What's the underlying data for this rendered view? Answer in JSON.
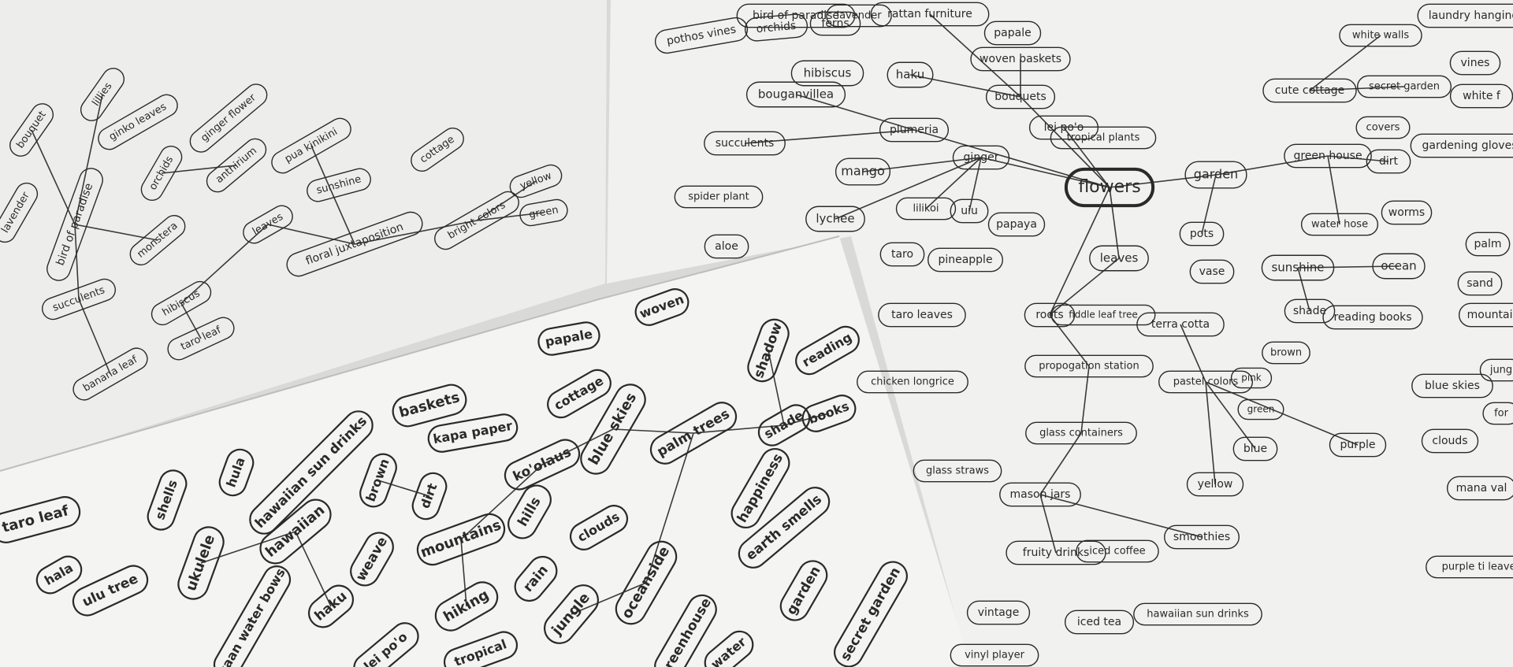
{
  "center_label": "flowers",
  "sheet_right": {
    "words": [
      "pothos vines",
      "orchids",
      "ferns",
      "bird of paradise",
      "lavender",
      "rattan furniture",
      "papale",
      "haku",
      "woven baskets",
      "bouquets",
      "bouganvillea",
      "hibiscus",
      "plumeria",
      "lei po'o",
      "tropical plants",
      "succulents",
      "ginger",
      "mango",
      "spider plant",
      "lychee",
      "lilikoi",
      "uiu",
      "papaya",
      "aloe",
      "taro",
      "pineapple",
      "taro leaves",
      "leaves",
      "roots",
      "fiddle leaf tree",
      "terra cotta",
      "pots",
      "vase",
      "garden",
      "dirt",
      "gardening gloves",
      "green house",
      "water hose",
      "worms",
      "cute cottage",
      "white walls",
      "secret garden",
      "vines",
      "white f",
      "covers",
      "laundry hanging",
      "sunshine",
      "shade",
      "reading books",
      "ocean",
      "palm",
      "sand",
      "mountain",
      "blue skies",
      "clouds",
      "jung",
      "for",
      "mana val",
      "purple ti leaves",
      "propogation station",
      "glass containers",
      "glass straws",
      "mason jars",
      "fruity drinks",
      "iced coffee",
      "smoothies",
      "pastel colors",
      "brown",
      "pink",
      "green",
      "blue",
      "purple",
      "yellow",
      "iced tea",
      "hawaiian sun drinks",
      "vintage",
      "vinyl player",
      "chicken longrice"
    ]
  },
  "sheet_left": {
    "words": [
      "bouquet",
      "lillies",
      "ginko leaves",
      "lavender",
      "bird of paradise",
      "orchids",
      "ginger flower",
      "anthirium",
      "pua kinikini",
      "sunshine",
      "cottage",
      "monstera",
      "leaves",
      "floral juxtaposition",
      "bright colors",
      "yellow",
      "green",
      "succulents",
      "hibiscus",
      "taro leaf",
      "banana leaf"
    ]
  },
  "sheet_bottom": {
    "words": [
      "taro leaf",
      "shells",
      "hula",
      "hawaiian sun drinks",
      "baskets",
      "kapa paper",
      "papale",
      "woven",
      "shadow",
      "reading",
      "books",
      "hala",
      "ulu tree",
      "ukulele",
      "hawaiian",
      "brown",
      "weave",
      "dirt",
      "mountains",
      "ko'olaus",
      "cottage",
      "blue skies",
      "palm trees",
      "shade",
      "hills",
      "clouds",
      "happiness",
      "hiking",
      "rain",
      "jungle",
      "oceanside",
      "earth smells",
      "haku",
      "kaan water bows",
      "lei po'o",
      "tropical",
      "greenhouse",
      "garden",
      "secret garden",
      "water"
    ]
  }
}
